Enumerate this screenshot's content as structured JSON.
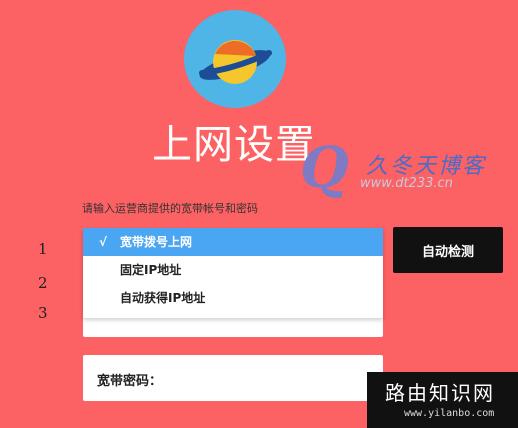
{
  "header": {
    "title": "上网设置"
  },
  "watermarks": {
    "blog_name": "久冬天博客",
    "blog_url": "www.dt233.cn",
    "router_name": "路由知识网",
    "router_url": "www.yilanbo.com"
  },
  "form": {
    "instruction": "请输入运营商提供的宽带帐号和密码",
    "steps": [
      "1",
      "2",
      "3"
    ],
    "connection_type_options": [
      {
        "label": "宽带拨号上网",
        "selected": true,
        "check": "√"
      },
      {
        "label": "固定IP地址",
        "selected": false
      },
      {
        "label": "自动获得IP地址",
        "selected": false
      }
    ],
    "auto_detect_label": "自动检测",
    "password_label": "宽带密码："
  },
  "colors": {
    "background": "#fc6163",
    "logo_circle": "#4fb4e6",
    "selected_option": "#4aa6f3",
    "button": "#111111"
  }
}
